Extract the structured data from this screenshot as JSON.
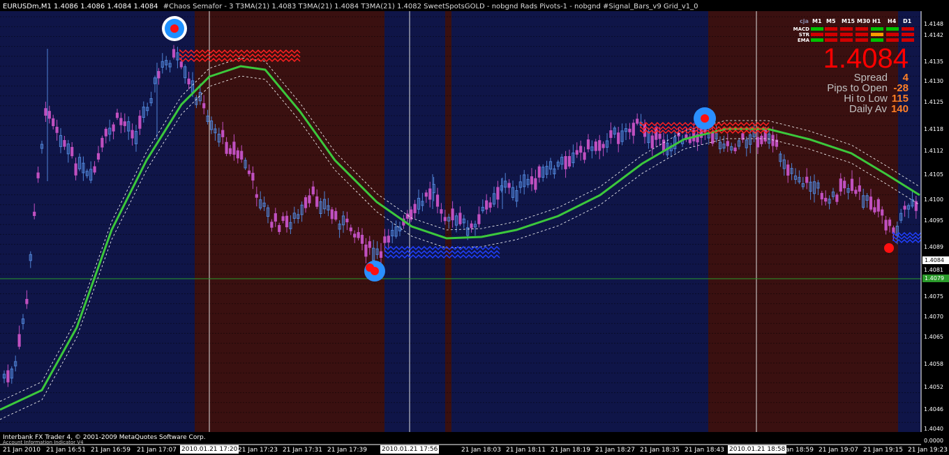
{
  "window": {
    "title": "EURUSDm,M1  1.4086 1.4086 1.4084 1.4084",
    "indicators": "#Chaos Semafor - 3  T3MA(21) 1.4083  T3MA(21) 1.4084  T3MA(21) 1.4082  SweetSpotsGOLD - nobgnd  Rads Pivots-1 - nobgnd  #Signal_Bars_v9  Grid_v1_0"
  },
  "footer": {
    "copyright": "Interbank FX Trader 4, © 2001-2009 MetaQuotes Software Corp.",
    "account": "Account  Information  Indicator  V4"
  },
  "signal_panel": {
    "owner": "cja",
    "timeframes": [
      "M1",
      "M5",
      "M15",
      "M30",
      "H1",
      "H4",
      "D1"
    ],
    "rows": [
      {
        "label": "MACD",
        "cells": [
          "#00c000",
          "#d00000",
          "#d00000",
          "#d00000",
          "#00c000",
          "#00c000",
          "#d00000"
        ]
      },
      {
        "label": "STR",
        "cells": [
          "#d00000",
          "#d00000",
          "#d00000",
          "#d00000",
          "#ff9900",
          "#d00000",
          "#d00000"
        ]
      },
      {
        "label": "EMA",
        "cells": [
          "#00c000",
          "#d00000",
          "#d00000",
          "#d00000",
          "#00c000",
          "#d00000",
          "#d00000"
        ]
      }
    ]
  },
  "price_display": {
    "current": "1.4084",
    "stats": [
      {
        "label": "Spread",
        "value": "4"
      },
      {
        "label": "Pips to Open",
        "value": "-28"
      },
      {
        "label": "Hi to Low",
        "value": "115"
      },
      {
        "label": "Daily Av",
        "value": "140"
      }
    ]
  },
  "price_axis": {
    "labels": [
      "1.4148",
      "1.4142",
      "1.4135",
      "1.4130",
      "1.4125",
      "1.4118",
      "1.4112",
      "1.4105",
      "1.4100",
      "1.4095",
      "1.4089",
      "1.4081",
      "1.4075",
      "1.4070",
      "1.4065",
      "1.4058",
      "1.4052",
      "1.4046",
      "1.4040",
      "0.0000"
    ],
    "current_price_box": "1.4084",
    "bid_box": "1.4079"
  },
  "time_axis": {
    "labels": [
      "21 Jan 2010",
      "21 Jan 16:51",
      "21 Jan 16:59",
      "21 Jan 17:07",
      "21 Jan 17:23",
      "21 Jan 17:31",
      "21 Jan 17:39",
      "21 Jan 18:03",
      "21 Jan 18:11",
      "21 Jan 18:19",
      "21 Jan 18:27",
      "21 Jan 18:35",
      "21 Jan 18:43",
      "21 Jan 18:59",
      "21 Jan 19:07",
      "21 Jan 19:15",
      "21 Jan 19:23"
    ],
    "highlighted": [
      "2010.01.21 17:20",
      "2010.01.21 17:56",
      "2010.01.21 18:58"
    ]
  },
  "colors": {
    "background_blue": "#0f1548",
    "background_red": "#3a1010",
    "bull_candle": "#4f83d6",
    "bear_candle": "#c050c0",
    "t3ma": "#3cc83c",
    "resistance": "#ff2020",
    "support": "#2040ff"
  }
}
